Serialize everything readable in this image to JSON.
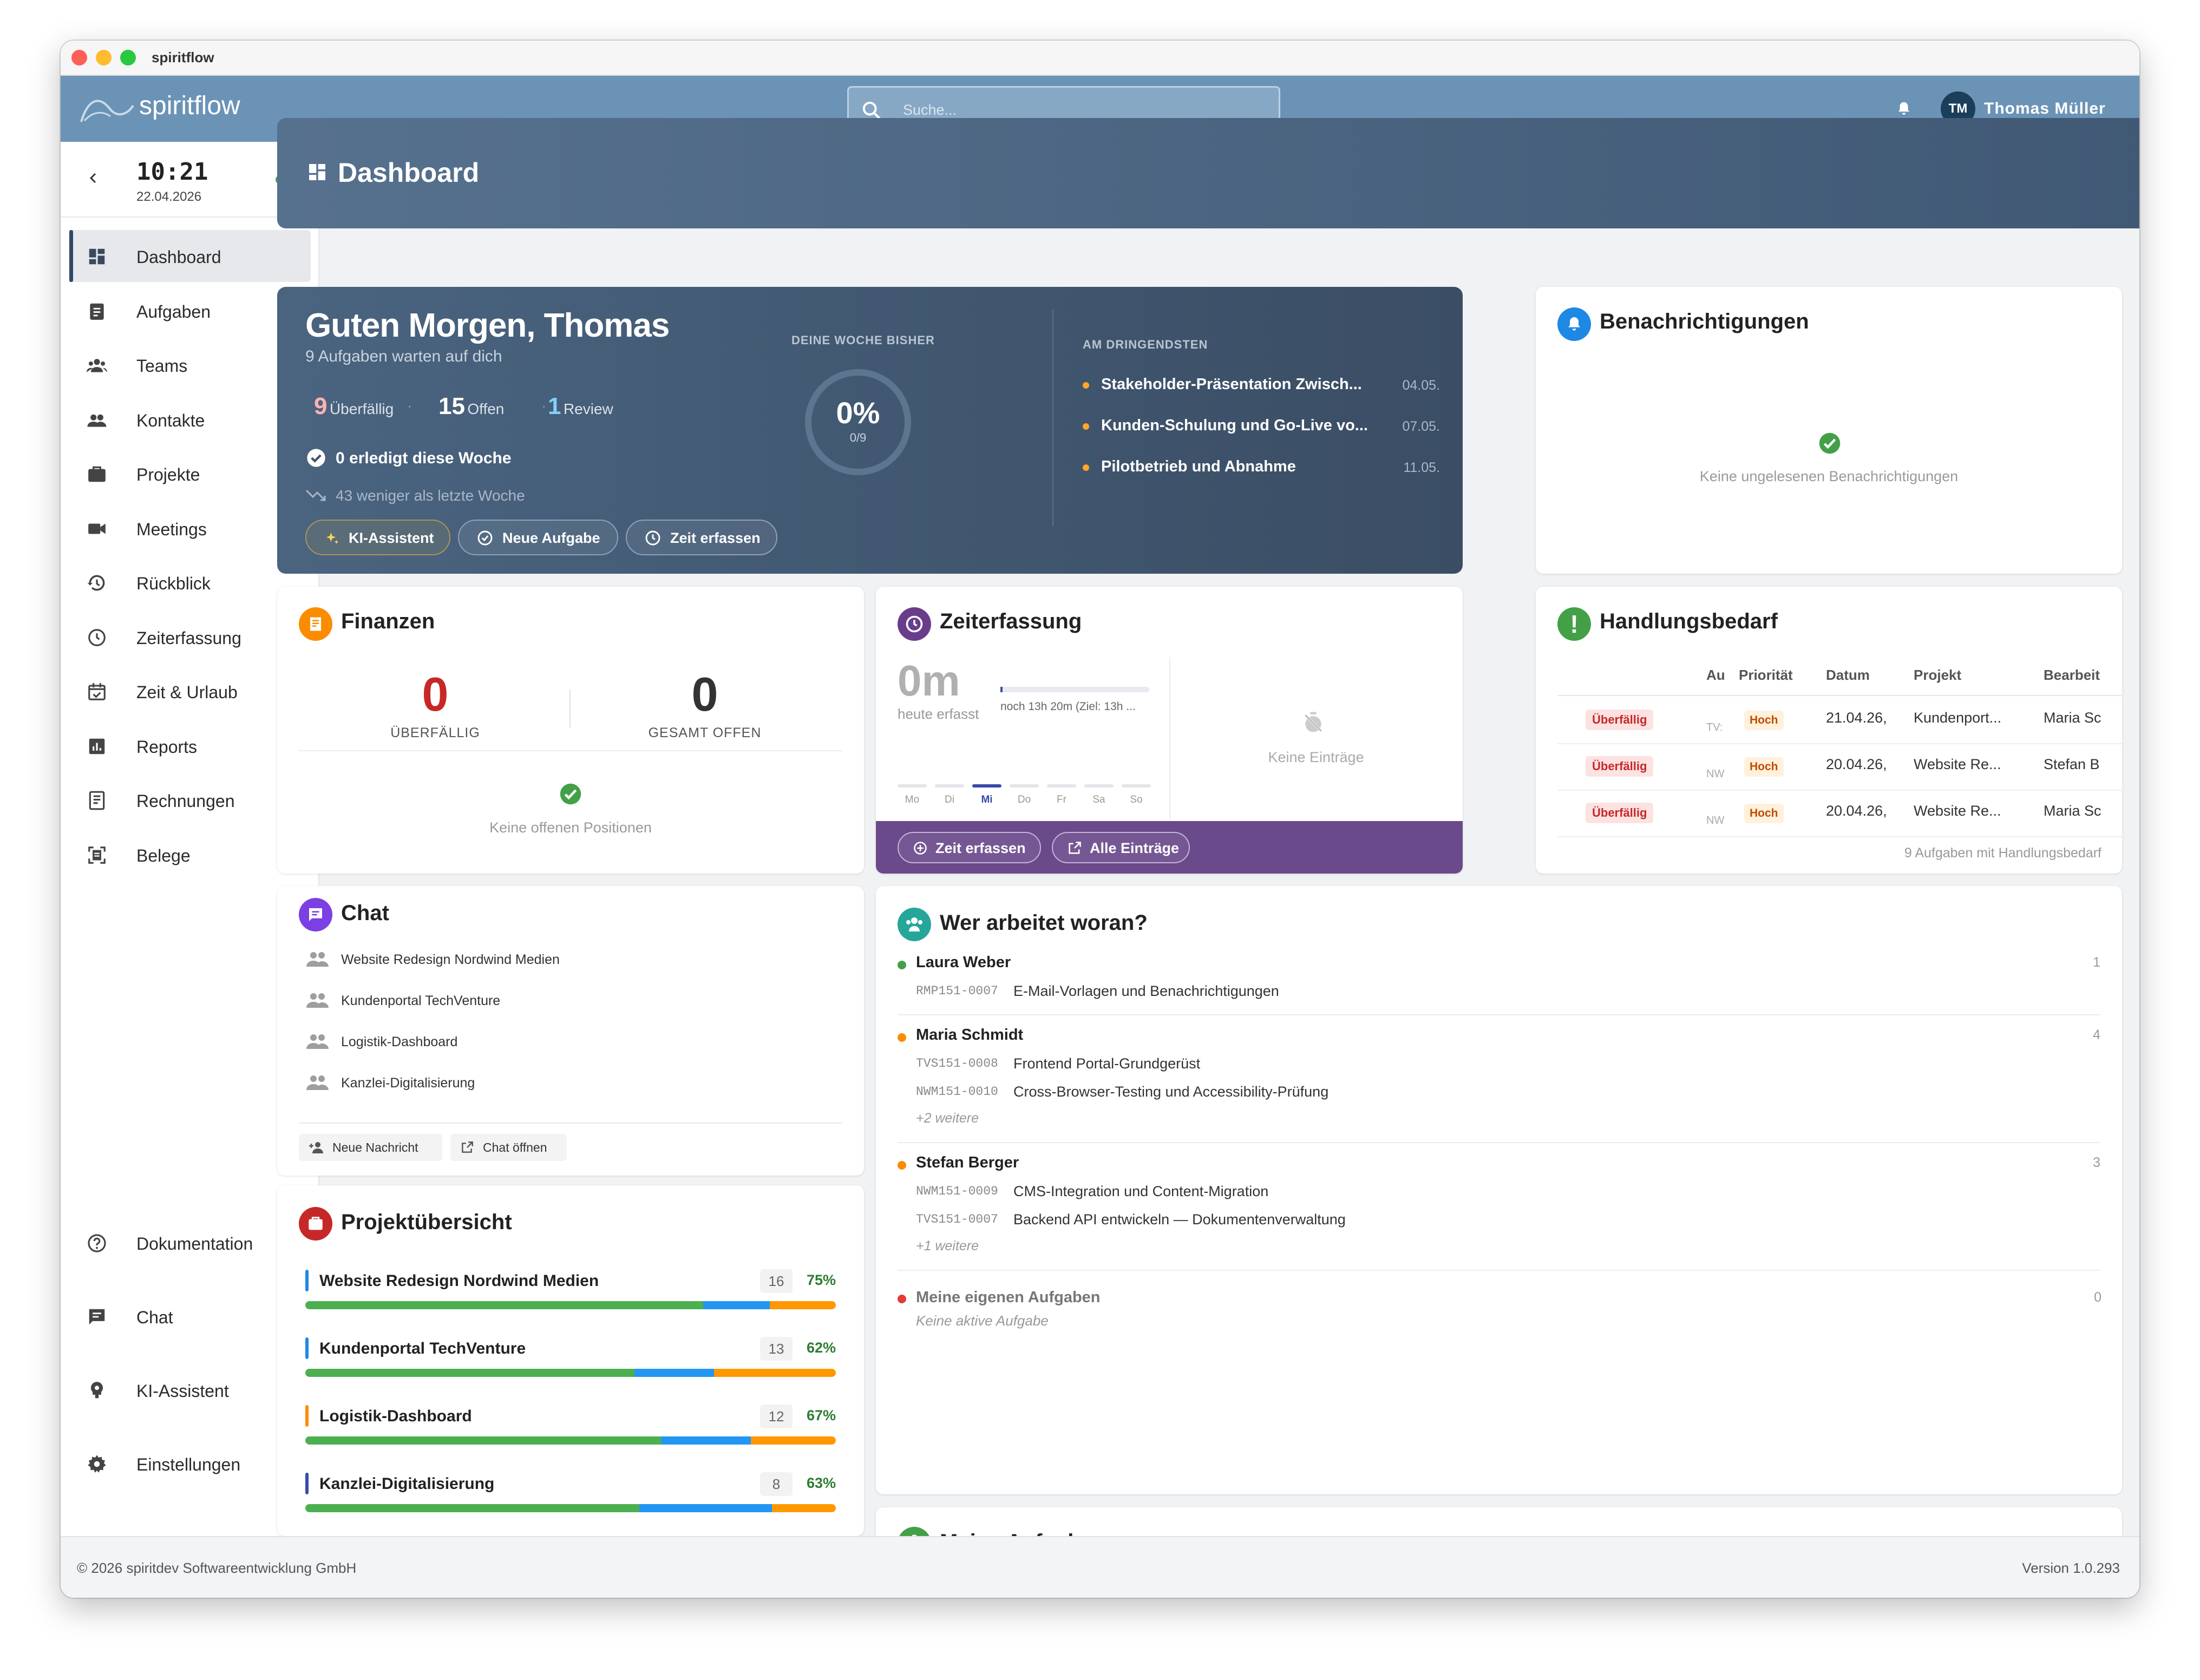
{
  "window": {
    "title": "spiritflow"
  },
  "header": {
    "brand": "spiritflow",
    "search_placeholder": "Suche...",
    "user_initials": "TM",
    "user_name": "Thomas Müller"
  },
  "sidebar": {
    "time": "10:21",
    "date": "22.04.2026",
    "items": [
      {
        "label": "Dashboard",
        "icon": "dashboard-icon"
      },
      {
        "label": "Aufgaben",
        "icon": "clipboard-icon"
      },
      {
        "label": "Teams",
        "icon": "team-icon"
      },
      {
        "label": "Kontakte",
        "icon": "contacts-icon"
      },
      {
        "label": "Projekte",
        "icon": "briefcase-icon"
      },
      {
        "label": "Meetings",
        "icon": "video-icon"
      },
      {
        "label": "Rückblick",
        "icon": "history-icon"
      },
      {
        "label": "Zeiterfassung",
        "icon": "clock-icon"
      },
      {
        "label": "Zeit & Urlaub",
        "icon": "calendar-check-icon"
      },
      {
        "label": "Reports",
        "icon": "chart-icon"
      },
      {
        "label": "Rechnungen",
        "icon": "invoice-icon"
      },
      {
        "label": "Belege",
        "icon": "receipt-scan-icon"
      }
    ],
    "bottom": [
      {
        "label": "Dokumentation",
        "icon": "help-icon"
      },
      {
        "label": "Chat",
        "icon": "chat-icon"
      },
      {
        "label": "KI-Assistent",
        "icon": "ai-icon"
      },
      {
        "label": "Einstellungen",
        "icon": "gear-icon"
      }
    ]
  },
  "dashboard": {
    "title": "Dashboard"
  },
  "greeting": {
    "title": "Guten Morgen, Thomas",
    "subtitle": "9 Aufgaben warten auf dich",
    "overdue_n": "9",
    "overdue_l": "Überfällig",
    "open_n": "15",
    "open_l": "Offen",
    "review_n": "1",
    "review_l": "Review",
    "done": "0 erledigt diese Woche",
    "trend": "43 weniger als letzte Woche",
    "week_label": "DEINE WOCHE BISHER",
    "week_pct": "0%",
    "week_frac": "0/9",
    "week_progress": 0,
    "urgent_label": "AM DRINGENDSTEN",
    "urgent": [
      {
        "title": "Stakeholder-Präsentation Zwisch...",
        "date": "04.05."
      },
      {
        "title": "Kunden-Schulung und Go-Live vo...",
        "date": "07.05."
      },
      {
        "title": "Pilotbetrieb und Abnahme",
        "date": "11.05."
      }
    ],
    "btn_ai": "KI-Assistent",
    "btn_task": "Neue Aufgabe",
    "btn_time": "Zeit erfassen"
  },
  "notifications": {
    "title": "Benachrichtigungen",
    "empty": "Keine ungelesenen Benachrichtigungen"
  },
  "finance": {
    "title": "Finanzen",
    "overdue_val": "0",
    "overdue_l": "ÜBERFÄLLIG",
    "open_val": "0",
    "open_l": "GESAMT OFFEN",
    "empty": "Keine offenen Positionen"
  },
  "time": {
    "title": "Zeiterfassung",
    "value": "0m",
    "label": "heute erfasst",
    "remaining": "noch 13h 20m (Ziel: 13h ...",
    "days": [
      "Mo",
      "Di",
      "Mi",
      "Do",
      "Fr",
      "Sa",
      "So"
    ],
    "empty": "Keine Einträge",
    "btn_add": "Zeit erfassen",
    "btn_all": "Alle Einträge"
  },
  "action": {
    "title": "Handlungsbedarf",
    "cols": [
      "Au",
      "Priorität",
      "Datum",
      "Projekt",
      "Bearbeit"
    ],
    "rows": [
      {
        "status": "Überfällig",
        "code": "TV:",
        "prio": "Hoch",
        "date": "21.04.26,",
        "proj": "Kundenport...",
        "user": "Maria Sc"
      },
      {
        "status": "Überfällig",
        "code": "NW",
        "prio": "Hoch",
        "date": "20.04.26,",
        "proj": "Website Re...",
        "user": "Stefan B"
      },
      {
        "status": "Überfällig",
        "code": "NW",
        "prio": "Hoch",
        "date": "20.04.26,",
        "proj": "Website Re...",
        "user": "Maria Sc"
      }
    ],
    "footer": "9 Aufgaben mit Handlungsbedarf"
  },
  "chat": {
    "title": "Chat",
    "items": [
      "Website Redesign Nordwind Medien",
      "Kundenportal TechVenture",
      "Logistik-Dashboard",
      "Kanzlei-Digitalisierung"
    ],
    "btn_new": "Neue Nachricht",
    "btn_open": "Chat öffnen"
  },
  "projects": {
    "title": "Projektübersicht",
    "items": [
      {
        "name": "Website Redesign Nordwind Medien",
        "count": "16",
        "pct": "75%",
        "color": "#1e88e5",
        "split": [
          75,
          12.5,
          12.5
        ]
      },
      {
        "name": "Kundenportal TechVenture",
        "count": "13",
        "pct": "62%",
        "color": "#1e88e5",
        "split": [
          62,
          15,
          23
        ]
      },
      {
        "name": "Logistik-Dashboard",
        "count": "12",
        "pct": "67%",
        "color": "#fb8c00",
        "split": [
          67,
          17,
          16
        ]
      },
      {
        "name": "Kanzlei-Digitalisierung",
        "count": "8",
        "pct": "63%",
        "color": "#3949ab",
        "split": [
          63,
          25,
          12
        ]
      }
    ]
  },
  "who": {
    "title": "Wer arbeitet woran?",
    "people": [
      {
        "name": "Laura Weber",
        "count": "1",
        "dot": "#43a047",
        "tasks": [
          {
            "code": "RMP151-0007",
            "text": "E-Mail-Vorlagen und Benachrichtigungen"
          }
        ],
        "more": ""
      },
      {
        "name": "Maria Schmidt",
        "count": "4",
        "dot": "#fb8c00",
        "tasks": [
          {
            "code": "TVS151-0008",
            "text": "Frontend Portal-Grundgerüst"
          },
          {
            "code": "NWM151-0010",
            "text": "Cross-Browser-Testing und Accessibility-Prüfung"
          }
        ],
        "more": "+2 weitere"
      },
      {
        "name": "Stefan Berger",
        "count": "3",
        "dot": "#fb8c00",
        "tasks": [
          {
            "code": "NWM151-0009",
            "text": "CMS-Integration und Content-Migration"
          },
          {
            "code": "TVS151-0007",
            "text": "Backend API entwickeln — Dokumentenverwaltung"
          }
        ],
        "more": "+1 weitere"
      }
    ],
    "own_title": "Meine eigenen Aufgaben",
    "own_count": "0",
    "own_empty": "Keine aktive Aufgabe"
  },
  "mytasks": {
    "title": "Meine Aufgaben"
  },
  "footer": {
    "copyright": "© 2026 spiritdev Softwareentwicklung GmbH",
    "version": "Version 1.0.293"
  }
}
